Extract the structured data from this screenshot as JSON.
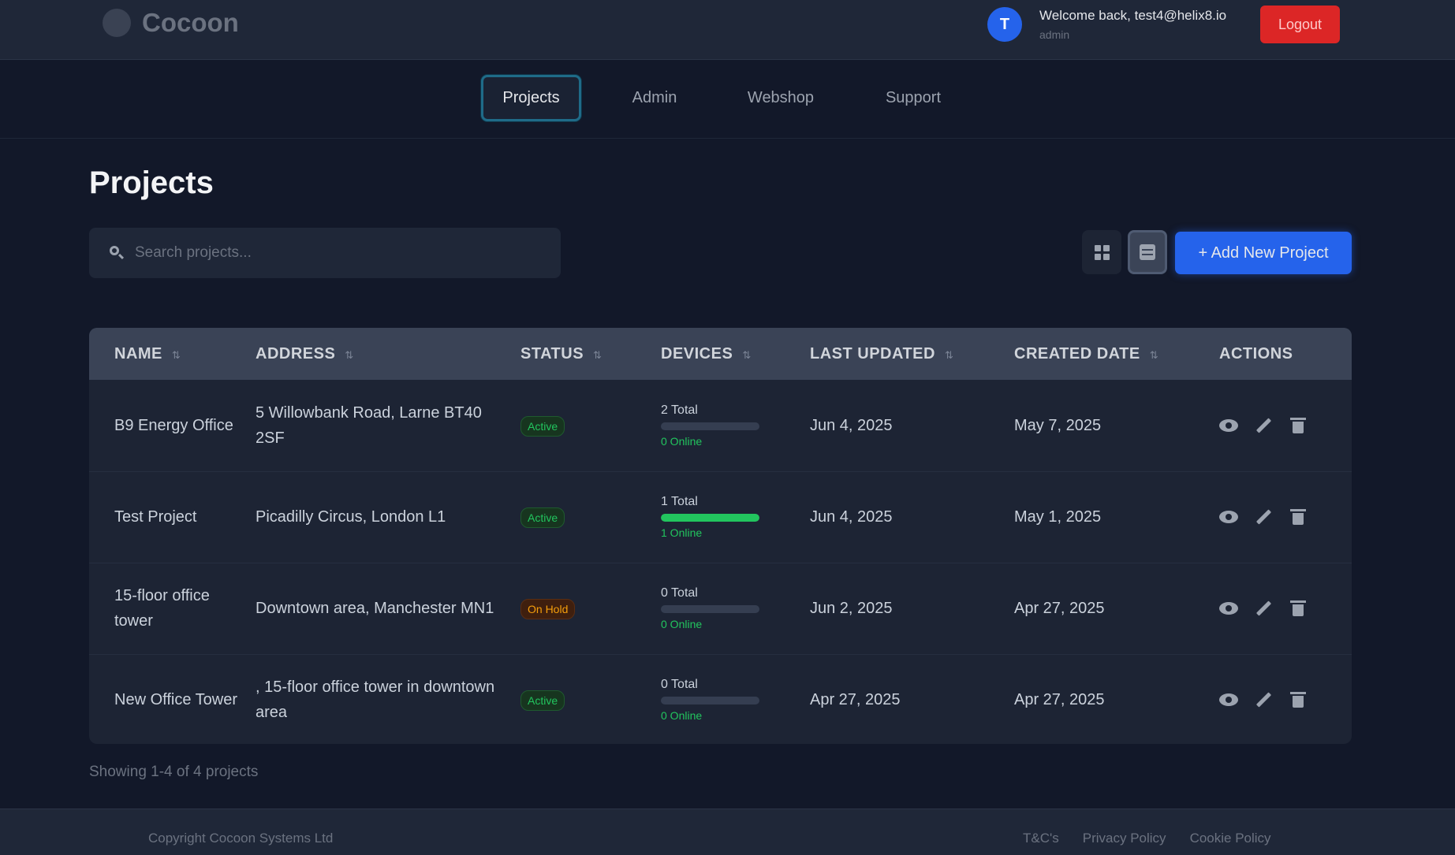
{
  "header": {
    "brand": "Cocoon",
    "avatar_initial": "T",
    "welcome": "Welcome back, test4@helix8.io",
    "role": "admin",
    "logout_label": "Logout"
  },
  "nav": {
    "tabs": [
      {
        "label": "Projects",
        "active": true
      },
      {
        "label": "Admin"
      },
      {
        "label": "Webshop"
      },
      {
        "label": "Support"
      }
    ]
  },
  "page": {
    "title": "Projects",
    "search_placeholder": "Search projects...",
    "search_value": "",
    "view_mode": "list",
    "add_label": "+ Add New Project"
  },
  "table": {
    "columns": [
      "NAME",
      "ADDRESS",
      "STATUS",
      "DEVICES",
      "LAST UPDATED",
      "CREATED DATE",
      "ACTIONS"
    ],
    "rows": [
      {
        "name": "B9 Energy Office",
        "address": "5 Willowbank Road, Larne BT40 2SF",
        "status": "Active",
        "devices_total": "2 Total",
        "devices_online": "0 Online",
        "online_fraction": 0,
        "last_updated": "Jun 4, 2025",
        "created": "May 7, 2025"
      },
      {
        "name": "Test Project",
        "address": "Picadilly Circus, London L1",
        "status": "Active",
        "devices_total": "1 Total",
        "devices_online": "1 Online",
        "online_fraction": 1,
        "last_updated": "Jun 4, 2025",
        "created": "May 1, 2025"
      },
      {
        "name": "15-floor office tower",
        "address": "Downtown area, Manchester MN1",
        "status": "On Hold",
        "devices_total": "0 Total",
        "devices_online": "0 Online",
        "online_fraction": 0,
        "last_updated": "Jun 2, 2025",
        "created": "Apr 27, 2025"
      },
      {
        "name": "New Office Tower",
        "address": ", 15-floor office tower in downtown area",
        "status": "Active",
        "devices_total": "0 Total",
        "devices_online": "0 Online",
        "online_fraction": 0,
        "last_updated": "Apr 27, 2025",
        "created": "Apr 27, 2025"
      }
    ]
  },
  "pagination": {
    "summary": "Showing 1-4 of 4 projects"
  },
  "footer": {
    "copyright": "Copyright Cocoon Systems Ltd",
    "links": [
      "T&C's",
      "Privacy Policy",
      "Cookie Policy"
    ]
  },
  "colors": {
    "accent": "#2563eb",
    "danger": "#dc2626",
    "success": "#22c55e",
    "warning": "#f59e0b",
    "background": "#121829"
  }
}
